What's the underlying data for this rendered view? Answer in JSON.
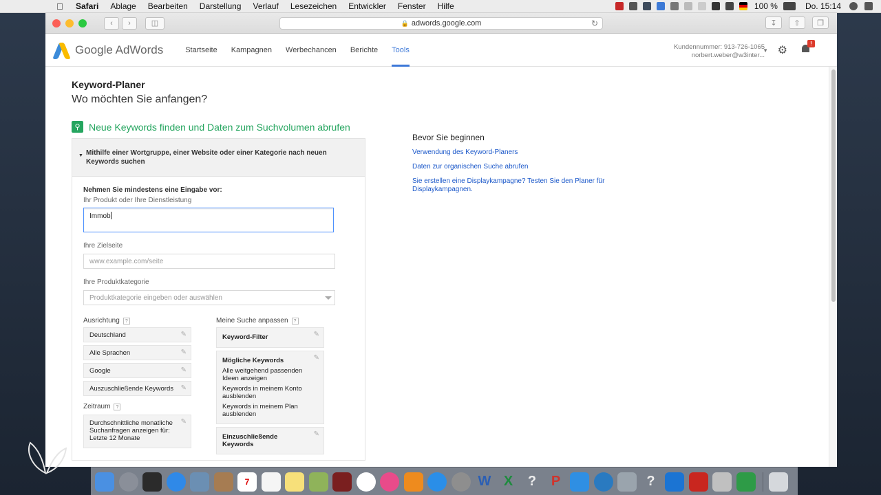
{
  "menubar": {
    "app": "Safari",
    "items": [
      "Ablage",
      "Bearbeiten",
      "Darstellung",
      "Verlauf",
      "Lesezeichen",
      "Entwickler",
      "Fenster",
      "Hilfe"
    ],
    "battery": "100 %",
    "clock": "Do. 15:14"
  },
  "browser": {
    "url": "adwords.google.com"
  },
  "adwords": {
    "brand": "Google AdWords",
    "nav": [
      "Startseite",
      "Kampagnen",
      "Werbechancen",
      "Berichte",
      "Tools"
    ],
    "active_tab": "Tools",
    "customer_number": "Kundennummer: 913-726-1065",
    "account_email": "norbert.weber@w3inter...",
    "notification_badge": "!"
  },
  "page": {
    "title": "Keyword-Planer",
    "subtitle": "Wo möchten Sie anfangen?",
    "section_title": "Neue Keywords finden und Daten zum Suchvolumen abrufen",
    "panel_header": "Mithilfe einer Wortgruppe, einer Website oder einer Kategorie nach neuen Keywords suchen",
    "form": {
      "intro": "Nehmen Sie mindestens eine Eingabe vor:",
      "product_label": "Ihr Produkt oder Ihre Dienstleistung",
      "product_value": "Immob",
      "landing_label": "Ihre Zielseite",
      "landing_placeholder": "www.example.com/seite",
      "category_label": "Ihre Produktkategorie",
      "category_placeholder": "Produktkategorie eingeben oder auswählen"
    },
    "targeting": {
      "heading": "Ausrichtung",
      "help": "?",
      "items": [
        "Deutschland",
        "Alle Sprachen",
        "Google",
        "Auszuschließende Keywords"
      ]
    },
    "period": {
      "heading": "Zeitraum",
      "help": "?",
      "text": "Durchschnittliche monatliche Suchanfragen anzeigen für: Letzte 12 Monate"
    },
    "customize": {
      "heading": "Meine Suche anpassen",
      "help": "?",
      "keyword_filter": "Keyword-Filter",
      "possible_title": "Mögliche Keywords",
      "possible_lines": [
        "Alle weitgehend passenden Ideen anzeigen",
        "Keywords in meinem Konto ausblenden",
        "Keywords in meinem Plan ausblenden"
      ],
      "include": "Einzuschließende Keywords"
    },
    "sidebar": {
      "heading": "Bevor Sie beginnen",
      "links": [
        "Verwendung des Keyword-Planers",
        "Daten zur organischen Suche abrufen",
        "Sie erstellen eine Displaykampagne? Testen Sie den Planer für Displaykampagnen."
      ]
    }
  },
  "colors": {
    "accent_green": "#25a55f",
    "link_blue": "#1a57c9",
    "tab_blue": "#3c78d8"
  }
}
